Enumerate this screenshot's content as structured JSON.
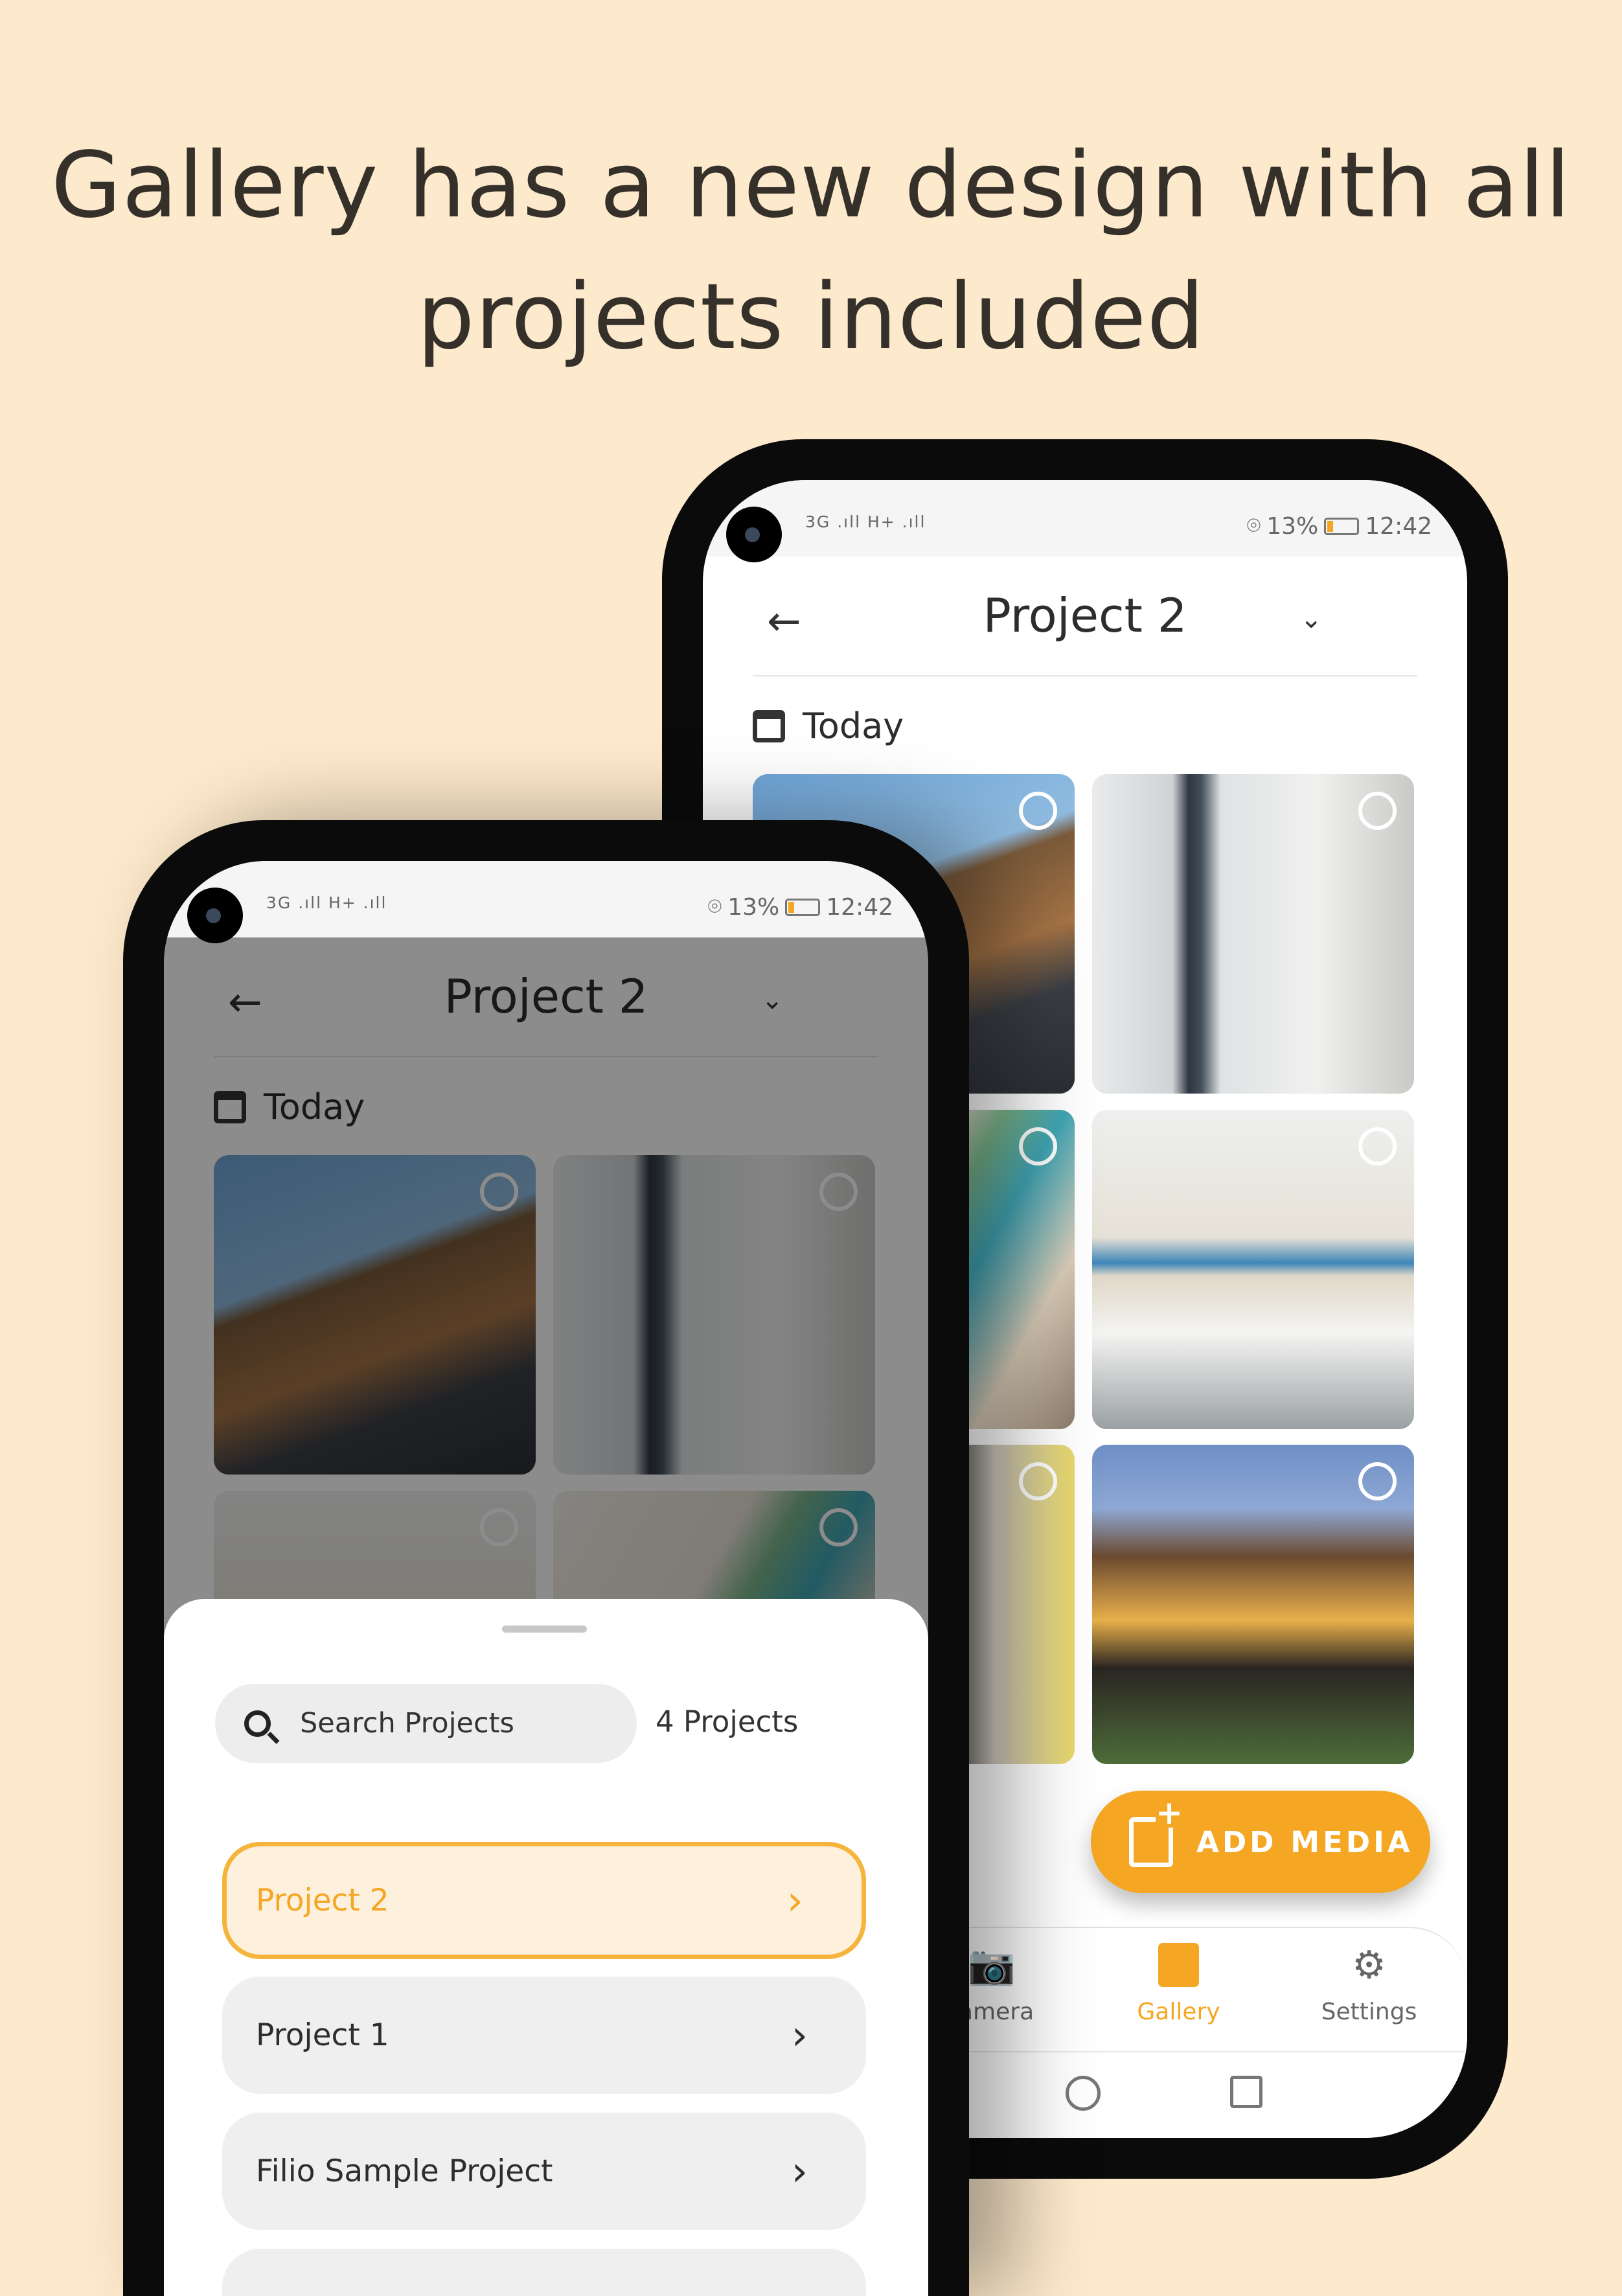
{
  "headline": {
    "line1": "Gallery has a new design with all",
    "line2": "projects included"
  },
  "status_bar": {
    "network": "3G .ıll H+ .ıll",
    "battery_percent": "13%",
    "battery_level": 0.13,
    "time": "12:42"
  },
  "header": {
    "back_icon": "arrow-left-icon",
    "title": "Project 2",
    "dropdown_icon": "chevron-down-icon"
  },
  "section": {
    "label": "Today",
    "icon": "calendar-icon"
  },
  "add_media": {
    "label": "ADD MEDIA",
    "icon": "add-photo-icon"
  },
  "bottom_nav": [
    {
      "label": "Camera",
      "icon": "camera-icon",
      "glyph": "📷",
      "active": false
    },
    {
      "label": "Gallery",
      "icon": "gallery-icon",
      "active": true
    },
    {
      "label": "Settings",
      "icon": "gear-icon",
      "glyph": "⚙",
      "active": false
    }
  ],
  "sheet": {
    "search_placeholder": "Search Projects",
    "count": "4 Projects",
    "projects": [
      {
        "name": "Project 2",
        "selected": true
      },
      {
        "name": "Project 1",
        "selected": false
      },
      {
        "name": "Filio Sample Project",
        "selected": false
      },
      {
        "name": "",
        "selected": false
      }
    ]
  },
  "colors": {
    "accent": "#f5a623",
    "background": "#fde9cb",
    "selected_bg": "#fdf1de"
  },
  "glyphs": {
    "back": "←",
    "dropdown": "⌄",
    "chevron": "›"
  }
}
